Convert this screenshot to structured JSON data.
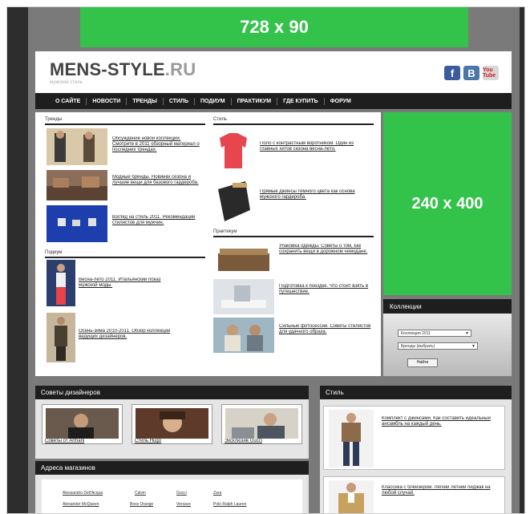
{
  "ads": {
    "top": "728 x 90",
    "side": "240 x 400"
  },
  "header": {
    "logo_main": "MENS-STYLE",
    "logo_tld": ".RU",
    "tagline": "мужской стиль",
    "social": [
      "f",
      "B",
      "You Tube"
    ]
  },
  "nav": [
    "О САЙТЕ",
    "НОВОСТИ",
    "ТРЕНДЫ",
    "СТИЛЬ",
    "ПОДИУМ",
    "ПРАКТИКУМ",
    "ГДЕ КУПИТЬ",
    "ФОРУМ"
  ],
  "sections": {
    "trends": {
      "title": "Тренды",
      "items": [
        "Обсуждение новой коллекции. Смотрите в 2011 обзорный материал о последних трендах.",
        "Модные бренды. Новинки сезона и лучшие вещи для базового гардероба.",
        "Взгляд на стиль 2011. Рекомендации стилистов для мужчин."
      ]
    },
    "style": {
      "title": "Стиль",
      "items": [
        "Поло с контрастным воротником. Один из главных хитов сезона весна-лето.",
        "Прямые джинсы тёмного цвета как основа мужского гардероба."
      ]
    },
    "podium": {
      "title": "Подиум",
      "items": [
        "Весна-лето 2011. Итальянский показ мужской моды.",
        "Осень-зима 2010-2011. Обзор коллекций ведущих дизайнеров."
      ]
    },
    "practicum": {
      "title": "Практикум",
      "items": [
        "Упаковка одежды. Советы о том, как сохранить вещи в дорожном чемодане.",
        "Подготовка к поездке. Что стоит взять в путешествие.",
        "Сильные фотосессии. Советы стилистов для удачного образа."
      ]
    }
  },
  "collections": {
    "title": "Коллекции",
    "select1": "Коллекция 2011",
    "select2": "Бренды (выбрать)",
    "button": "Найти"
  },
  "designers": {
    "title": "Советы дизайнеров",
    "items": [
      "Советы от Armani",
      "Стиль Hugo",
      "Эксклюзив Gucci"
    ]
  },
  "addresses": {
    "title": "Адреса магазинов",
    "links": [
      "Alessandro Dell'Acqua",
      "Calvin",
      "Gucci",
      "Zara",
      "Alexander McQueen",
      "Boss Orange",
      "Versace",
      "Polo Ralph Lauren"
    ]
  },
  "style_panel": {
    "title": "Стиль",
    "items": [
      "Комплект с джинсами. Как составить идеальный ансамбль на каждый день.",
      "Классика с блейзером. Лёгкий летний пиджак на любой случай."
    ]
  }
}
